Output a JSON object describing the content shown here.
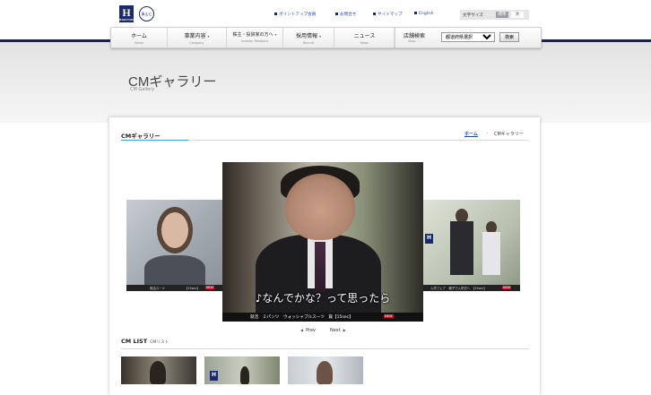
{
  "header": {
    "logo_text": "H",
    "logo_sub": "HARUYAMA",
    "badge_text": "青山と",
    "links": [
      "ポイントアップ会員",
      "お問合せ",
      "サイトマップ",
      "English"
    ],
    "font_size": {
      "label": "文字サイズ",
      "standard": "標準",
      "large": "大"
    }
  },
  "nav": [
    {
      "jp": "ホーム",
      "en": "Home"
    },
    {
      "jp": "事業内容",
      "en": "Company"
    },
    {
      "jp": "株主・投資家の方へ",
      "en": "Investor Relations"
    },
    {
      "jp": "採用情報",
      "en": "Recruit"
    },
    {
      "jp": "ニュース",
      "en": "News"
    }
  ],
  "shop_search": {
    "jp": "店舗検索",
    "en": "Shop",
    "select_value": "都道府県選択",
    "button": "検索"
  },
  "page": {
    "title": "CMギャラリー",
    "subtitle": "CM Gallery"
  },
  "section": {
    "title": "CMギャラリー"
  },
  "breadcrumb": {
    "home": "ホーム",
    "sep": "›",
    "current": "CMギャラリー"
  },
  "carousel": {
    "main": {
      "subtitle": "♪なんでかな？って思ったら",
      "caption": "就活　２パンツ　ウォッシャブルスーツ　篇【15sec】",
      "tag": "NEW"
    },
    "left": {
      "caption": "就活スーツ　　　　　　　【15sec】",
      "tag": "NEW"
    },
    "right": {
      "caption": "入学フェア　親子で入学式へ　【15sec】",
      "tag": "NEW"
    },
    "prev": "Prev",
    "next": "Next"
  },
  "cm_list": {
    "title": "CM LIST",
    "subtitle": "CMリスト"
  },
  "colors": {
    "navy": "#1b2a6b",
    "accent": "#3ab0d8",
    "new_tag": "#c8102e"
  }
}
